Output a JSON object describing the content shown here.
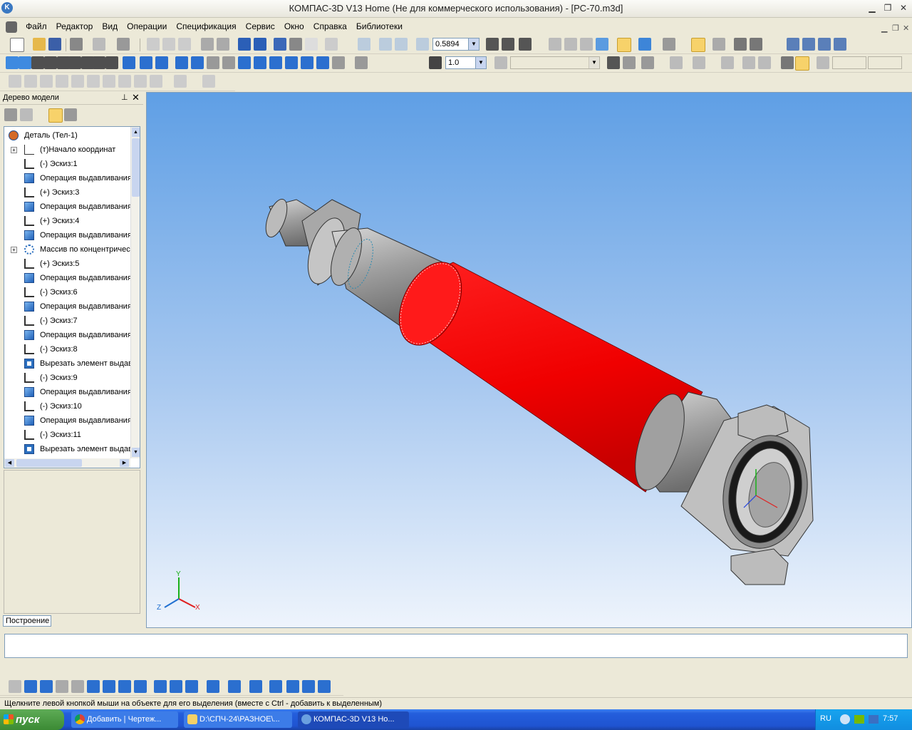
{
  "window": {
    "title": "КОМПАС-3D V13 Home (Не для коммерческого использования) - [РС-70.m3d]"
  },
  "menu": [
    "Файл",
    "Редактор",
    "Вид",
    "Операции",
    "Спецификация",
    "Сервис",
    "Окно",
    "Справка",
    "Библиотеки"
  ],
  "toolbar": {
    "zoom_value": "0.5894",
    "step_value": "1.0"
  },
  "tree_panel": {
    "title": "Дерево модели",
    "items": [
      {
        "label": "Деталь (Тел-1)",
        "icon": "part-icon",
        "indent": 0,
        "expand": false
      },
      {
        "label": "(т)Начало координат",
        "icon": "origin-icon",
        "indent": 1,
        "expand": true
      },
      {
        "label": "(-) Эскиз:1",
        "icon": "sketch-icon",
        "indent": 1,
        "expand": false
      },
      {
        "label": "Операция выдавливания",
        "icon": "extrude-icon",
        "indent": 1,
        "expand": false
      },
      {
        "label": "(+) Эскиз:3",
        "icon": "sketch-icon",
        "indent": 1,
        "expand": false
      },
      {
        "label": "Операция выдавливания",
        "icon": "extrude-icon",
        "indent": 1,
        "expand": false
      },
      {
        "label": "(+) Эскиз:4",
        "icon": "sketch-icon",
        "indent": 1,
        "expand": false
      },
      {
        "label": "Операция выдавливания",
        "icon": "extrude-icon",
        "indent": 1,
        "expand": false
      },
      {
        "label": "Массив по концентрической",
        "icon": "array-icon",
        "indent": 1,
        "expand": true
      },
      {
        "label": "(+) Эскиз:5",
        "icon": "sketch-icon",
        "indent": 1,
        "expand": false
      },
      {
        "label": "Операция выдавливания",
        "icon": "extrude-icon",
        "indent": 1,
        "expand": false
      },
      {
        "label": "(-) Эскиз:6",
        "icon": "sketch-icon",
        "indent": 1,
        "expand": false
      },
      {
        "label": "Операция выдавливания",
        "icon": "extrude-icon",
        "indent": 1,
        "expand": false
      },
      {
        "label": "(-) Эскиз:7",
        "icon": "sketch-icon",
        "indent": 1,
        "expand": false
      },
      {
        "label": "Операция выдавливания",
        "icon": "extrude-icon",
        "indent": 1,
        "expand": false
      },
      {
        "label": "(-) Эскиз:8",
        "icon": "sketch-icon",
        "indent": 1,
        "expand": false
      },
      {
        "label": "Вырезать элемент выдавливания",
        "icon": "cut-extrude-icon",
        "indent": 1,
        "expand": false
      },
      {
        "label": "(-) Эскиз:9",
        "icon": "sketch-icon",
        "indent": 1,
        "expand": false
      },
      {
        "label": "Операция выдавливания",
        "icon": "extrude-icon",
        "indent": 1,
        "expand": false
      },
      {
        "label": "(-) Эскиз:10",
        "icon": "sketch-icon",
        "indent": 1,
        "expand": false
      },
      {
        "label": "Операция выдавливания",
        "icon": "extrude-icon",
        "indent": 1,
        "expand": false
      },
      {
        "label": "(-) Эскиз:11",
        "icon": "sketch-icon",
        "indent": 1,
        "expand": false
      },
      {
        "label": "Вырезать элемент выдавливания",
        "icon": "cut-extrude-icon",
        "indent": 1,
        "expand": false
      }
    ],
    "tab_label": "Построение"
  },
  "viewport": {
    "axis_x": "X",
    "axis_y": "Y",
    "axis_z": "Z",
    "highlight_color": "#ff0000",
    "body_color": "#a9a9a9"
  },
  "status": {
    "hint": "Щелкните левой кнопкой мыши на объекте для его выделения (вместе с Ctrl - добавить к выделенным)"
  },
  "taskbar": {
    "start_label": "пуск",
    "tasks": [
      {
        "label": "Добавить | Чертеж...",
        "icon": "chrome-icon"
      },
      {
        "label": "D:\\СПЧ-24\\РАЗНОЕ\\...",
        "icon": "folder-icon"
      },
      {
        "label": "КОМПАС-3D V13 Но...",
        "icon": "kompas-icon"
      }
    ],
    "lang": "RU",
    "clock": "7:57"
  }
}
